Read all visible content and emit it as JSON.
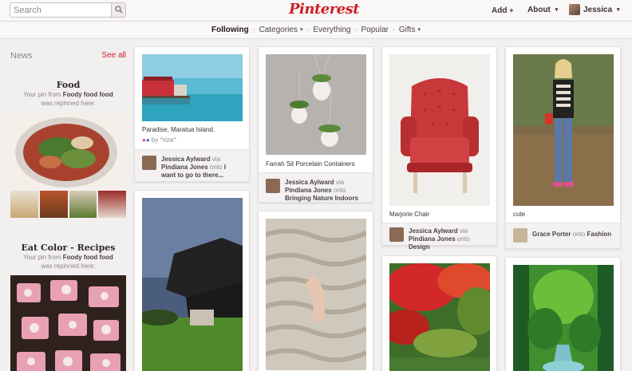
{
  "header": {
    "search_placeholder": "Search",
    "logo": "Pinterest",
    "add_label": "Add",
    "add_suffix": "+",
    "about_label": "About",
    "user_name": "Jessica",
    "caret": "▾"
  },
  "nav": {
    "items": [
      "Following",
      "Categories",
      "Everything",
      "Popular",
      "Gifts"
    ],
    "separator": "·",
    "active": "Following"
  },
  "sidebar": {
    "title": "News",
    "see_all": "See all",
    "feeds": [
      {
        "title": "Food",
        "line1_pre": "Your pin from ",
        "line1_bold": "Foody food food",
        "line2": "was repinned here:"
      },
      {
        "title": "Eat Color - Recipes",
        "line1_pre": "Your pin from ",
        "line1_bold": "Foody food food",
        "line2": "was repinned here:"
      }
    ]
  },
  "pins": [
    {
      "desc": "Paradise, Maratua Island.",
      "by": "by ^riza^",
      "user": "Jessica Aylward",
      "via": "via",
      "via_user": "Pindiana Jones",
      "onto": "onto",
      "board": "I want to go to there..."
    },
    {
      "desc": "Farrah Sit Porcelain Containers",
      "user": "Jessica Aylward",
      "via": "via",
      "via_user": "Pindiana Jones",
      "onto": "onto",
      "board": "Bringing Nature Indoors"
    },
    {
      "desc": "Marjorie Chair",
      "user": "Jessica Aylward",
      "via": "via",
      "via_user": "Pindiana Jones",
      "onto": "onto",
      "board": "Design"
    },
    {
      "desc": "cute",
      "user": "Grace Porter",
      "onto": "onto",
      "board": "Fashion"
    }
  ],
  "colors": {
    "brand": "#cb2027",
    "background": "#f2f0f0"
  }
}
